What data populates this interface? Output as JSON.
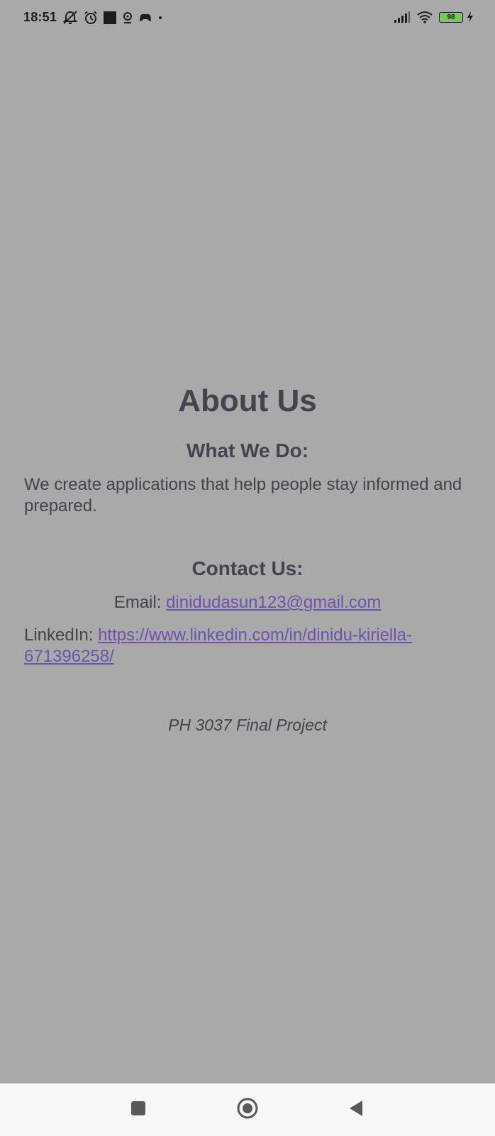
{
  "status_bar": {
    "time": "18:51",
    "battery_level": "98",
    "battery_fraction": 0.98,
    "left_icons": [
      "mute-icon",
      "alarm-icon",
      "square-notification-icon",
      "location-pin-icon",
      "gamepad-icon",
      "dot-icon"
    ],
    "right_icons": [
      "signal-bars-icon",
      "wifi-icon",
      "battery-icon",
      "charging-icon"
    ]
  },
  "about": {
    "title": "About Us",
    "what_heading": "What We Do:",
    "what_body": "We create applications that help people stay informed and prepared.",
    "contact_heading": "Contact Us:",
    "email_label": "Email: ",
    "email_value": "dinidudasun123@gmail.com",
    "linkedin_label": "LinkedIn: ",
    "linkedin_value": "https://www.linkedin.com/in/dinidu-kiriella-671396258/",
    "footer": "PH 3037 Final Project"
  },
  "nav": {
    "items": [
      "recents-square-icon",
      "home-circle-icon",
      "back-triangle-icon"
    ]
  },
  "colors": {
    "background": "#a9a9a9",
    "text": "#45434d",
    "link": "#6c54ad",
    "nav_bar": "#f7f7f7",
    "battery_fill": "#6bd34a"
  }
}
